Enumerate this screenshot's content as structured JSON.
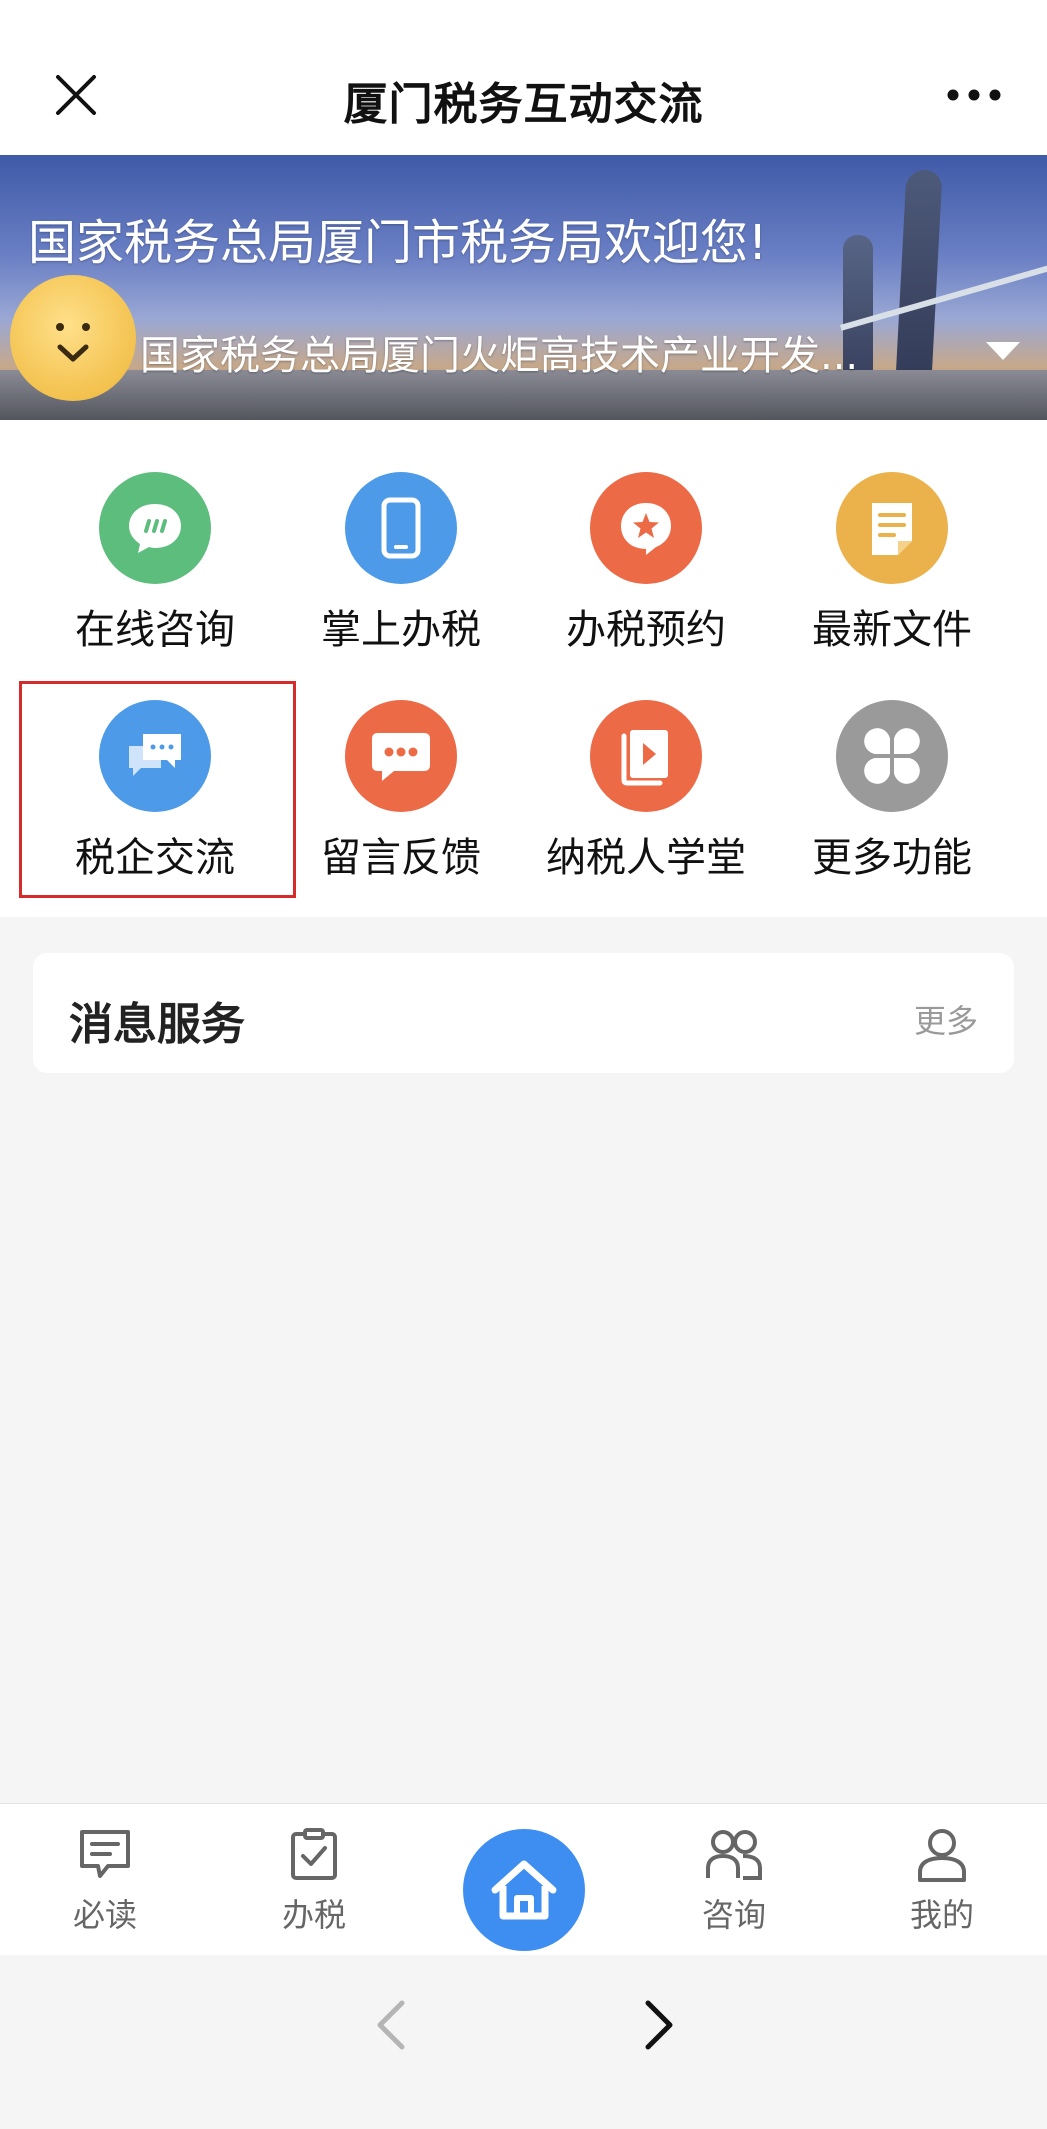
{
  "header": {
    "title": "厦门税务互动交流"
  },
  "banner": {
    "welcome": "国家税务总局厦门市税务局欢迎您!",
    "org_selected": "国家税务总局厦门火炬高技术产业开发..."
  },
  "grid": {
    "items": [
      {
        "label": "在线咨询",
        "icon": "chat-bubble-icon",
        "color": "#5dbd7d"
      },
      {
        "label": "掌上办税",
        "icon": "mobile-phone-icon",
        "color": "#4d9be8"
      },
      {
        "label": "办税预约",
        "icon": "star-bubble-icon",
        "color": "#ec6a45"
      },
      {
        "label": "最新文件",
        "icon": "document-icon",
        "color": "#ebb24c"
      },
      {
        "label": "税企交流",
        "icon": "conversation-icon",
        "color": "#4d9be8"
      },
      {
        "label": "留言反馈",
        "icon": "message-dots-icon",
        "color": "#ec6a45"
      },
      {
        "label": "纳税人学堂",
        "icon": "video-book-icon",
        "color": "#ec6a45"
      },
      {
        "label": "更多功能",
        "icon": "four-petal-icon",
        "color": "#9a9a9a"
      }
    ]
  },
  "message_section": {
    "title": "消息服务",
    "more": "更多"
  },
  "bottom_nav": {
    "items": [
      {
        "label": "必读",
        "icon": "read-icon"
      },
      {
        "label": "办税",
        "icon": "clipboard-icon"
      },
      {
        "label": "",
        "icon": "home-icon"
      },
      {
        "label": "咨询",
        "icon": "people-icon"
      },
      {
        "label": "我的",
        "icon": "user-icon"
      }
    ]
  },
  "colors": {
    "accent": "#3d8ef0",
    "highlight_border": "#d52b2b"
  }
}
